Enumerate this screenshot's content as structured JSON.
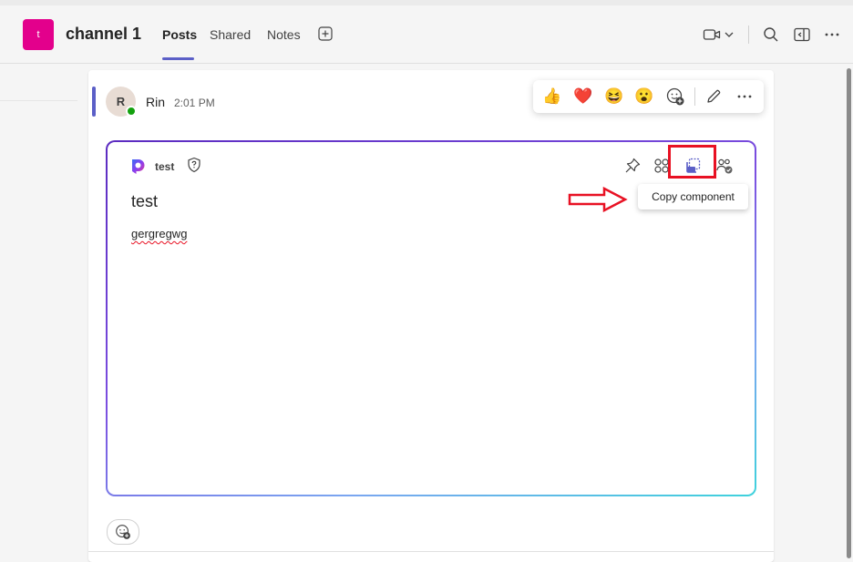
{
  "header": {
    "team_avatar_letter": "t",
    "channel_title": "channel 1",
    "tabs": [
      {
        "label": "Posts",
        "active": true
      },
      {
        "label": "Shared",
        "active": false
      },
      {
        "label": "Notes",
        "active": false
      }
    ],
    "icons": [
      "add-tab-icon",
      "video-icon",
      "chevron-down-icon",
      "search-icon",
      "pane-toggle-icon",
      "more-icon"
    ]
  },
  "post": {
    "author_initial": "R",
    "author": "Rin",
    "time": "2:01 PM",
    "presence": "available",
    "reactions": [
      "👍",
      "❤️",
      "😆",
      "😮"
    ]
  },
  "loop_card": {
    "app_name": "test",
    "title": "test",
    "body_text": "gergregwg",
    "tooltip": "Copy component"
  },
  "colors": {
    "accent": "#5b5fc7",
    "team_avatar": "#e3008c",
    "annotation_red": "#e81123",
    "presence": "#13a10e"
  }
}
